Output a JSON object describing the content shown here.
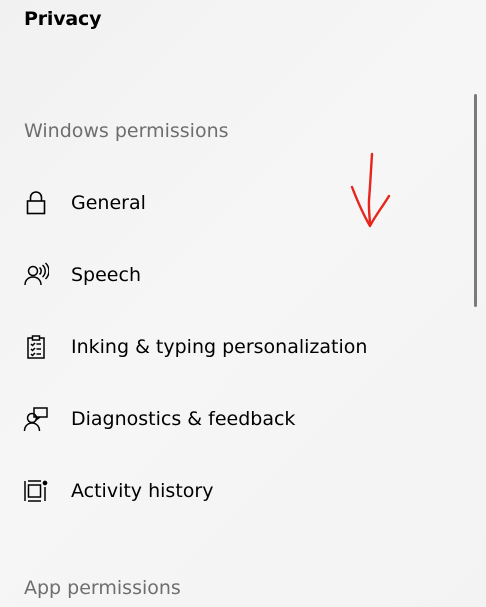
{
  "page": {
    "title": "Privacy"
  },
  "sections": {
    "windows_permissions": "Windows permissions",
    "app_permissions": "App permissions"
  },
  "nav_items": [
    {
      "label": "General",
      "icon": "lock-icon"
    },
    {
      "label": "Speech",
      "icon": "speech-icon"
    },
    {
      "label": "Inking & typing personalization",
      "icon": "clipboard-checklist-icon"
    },
    {
      "label": "Diagnostics & feedback",
      "icon": "diagnostics-feedback-icon"
    },
    {
      "label": "Activity history",
      "icon": "activity-history-icon"
    }
  ],
  "colors": {
    "annotation": "#e8251c",
    "section_header": "#6e6e6e",
    "scrollbar": "#7a7a7a"
  }
}
